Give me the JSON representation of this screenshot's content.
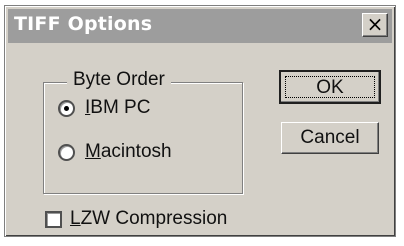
{
  "window": {
    "title": "TIFF Options",
    "close_glyph": "×"
  },
  "byte_order": {
    "label": "Byte Order",
    "options": [
      {
        "prefix": "",
        "mnemonic": "I",
        "rest": "BM PC",
        "selected": true
      },
      {
        "prefix": "",
        "mnemonic": "M",
        "rest": "acintosh",
        "selected": false
      }
    ]
  },
  "buttons": {
    "ok": "OK",
    "cancel": "Cancel"
  },
  "lzw": {
    "mnemonic": "L",
    "rest": "ZW Compression",
    "checked": false
  },
  "colors": {
    "dialog_face": "#d4d0c8",
    "titlebar": "#9d9d9d",
    "title_text": "#ffffff"
  }
}
